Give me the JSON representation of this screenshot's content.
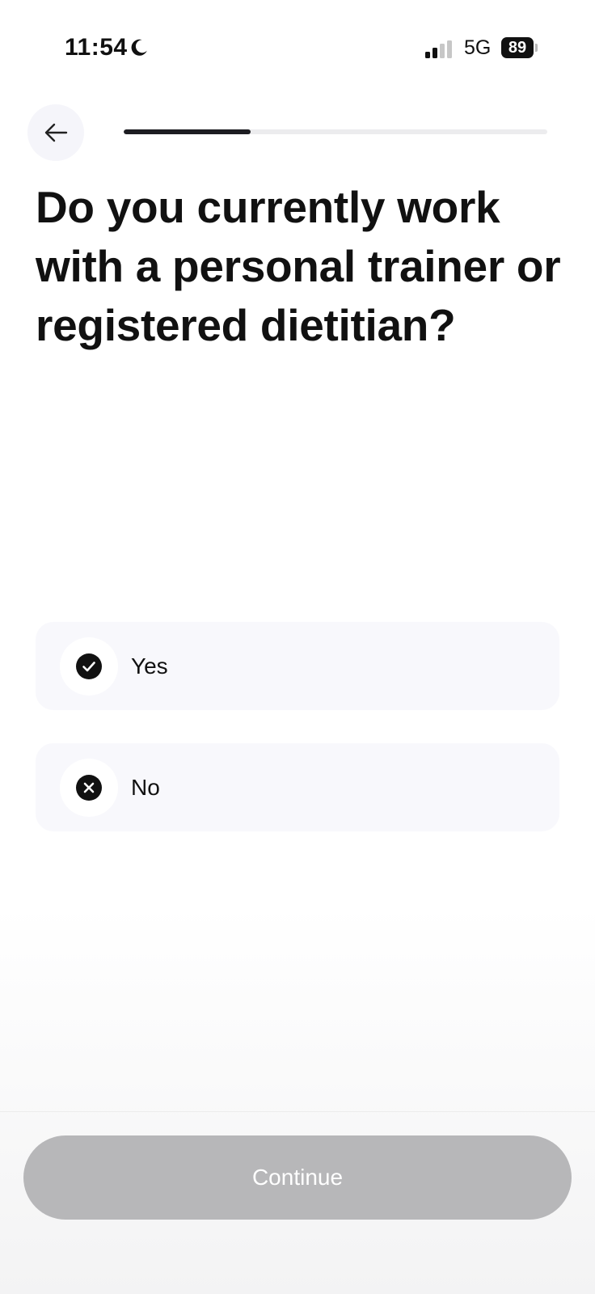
{
  "status_bar": {
    "time": "11:54",
    "network": "5G",
    "battery": "89",
    "icons": [
      "moon-icon",
      "signal-icon"
    ]
  },
  "header": {
    "back_icon": "arrow-left-icon",
    "progress": 0.3
  },
  "question": "Do you currently work with a personal trainer or registered dietitian?",
  "options": [
    {
      "label": "Yes",
      "icon": "check-circle-icon"
    },
    {
      "label": "No",
      "icon": "x-circle-icon"
    }
  ],
  "continue_label": "Continue",
  "colors": {
    "accent": "#1d1d22",
    "option_bg": "#f8f8fc",
    "button_disabled": "#b7b7b9"
  }
}
